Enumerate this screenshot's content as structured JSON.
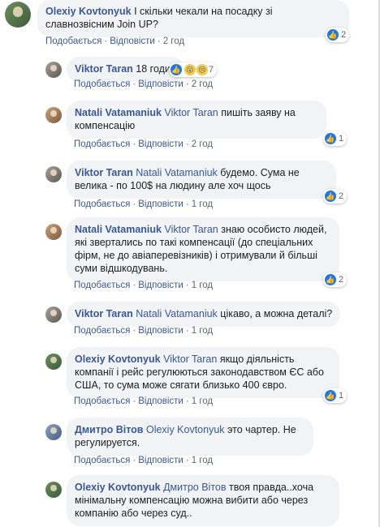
{
  "ui": {
    "like": "Подобається",
    "reply": "Відповісти"
  },
  "comments": [
    {
      "author": "Olexiy Kovtonyuk",
      "tag": "",
      "text": "І скільки чекали на посадку зі славнозвісним Join UP?",
      "time": "2 год",
      "reactions": {
        "count": "2",
        "types": [
          "like"
        ]
      }
    },
    {
      "author": "Viktor Taran",
      "tag": "",
      "text": "18 годин",
      "time": "2 год",
      "reactions": {
        "count": "7",
        "types": [
          "like",
          "wow",
          "sad"
        ]
      }
    },
    {
      "author": "Natali Vatamaniuk",
      "tag": "Viktor Taran",
      "text": "пишіть заяву на компенсацію",
      "time": "2 год",
      "reactions": {
        "count": "1",
        "types": [
          "like"
        ]
      }
    },
    {
      "author": "Viktor Taran",
      "tag": "Natali Vatamaniuk",
      "text": "будемо. Сума не велика - по 100$ на людину але хоч щось",
      "time": "1 год",
      "reactions": {
        "count": "2",
        "types": [
          "like"
        ]
      }
    },
    {
      "author": "Natali Vatamaniuk",
      "tag": "Viktor Taran",
      "text": "знаю особисто людей, які звертались по такі компенсації (до спеціальних фірм, не до авіаперевізників) і отримували й більші суми відшкодувань.",
      "time": "1 год",
      "reactions": {
        "count": "2",
        "types": [
          "like"
        ]
      }
    },
    {
      "author": "Viktor Taran",
      "tag": "Natali Vatamaniuk",
      "text": "цікаво, а можна деталі?",
      "time": "1 год",
      "reactions": null
    },
    {
      "author": "Olexiy Kovtonyuk",
      "tag": "Viktor Taran",
      "text": "якщо діяльність компанії і рейс регулюються законодавством ЄС або США, то сума може сягати близько 400 євро.",
      "time": "1 год",
      "reactions": {
        "count": "1",
        "types": [
          "like"
        ]
      }
    },
    {
      "author": "Дмитро Вітов",
      "tag": "Olexiy Kovtonyuk",
      "text": "это чартер. Не регулируется.",
      "time": "1 год",
      "reactions": null
    },
    {
      "author": "Olexiy Kovtonyuk",
      "tag": "Дмитро Вітов",
      "text": "твоя правда..хоча мінімальну компенсацію можна вибити або через компанію або через суд..",
      "time": "",
      "reactions": null
    }
  ]
}
